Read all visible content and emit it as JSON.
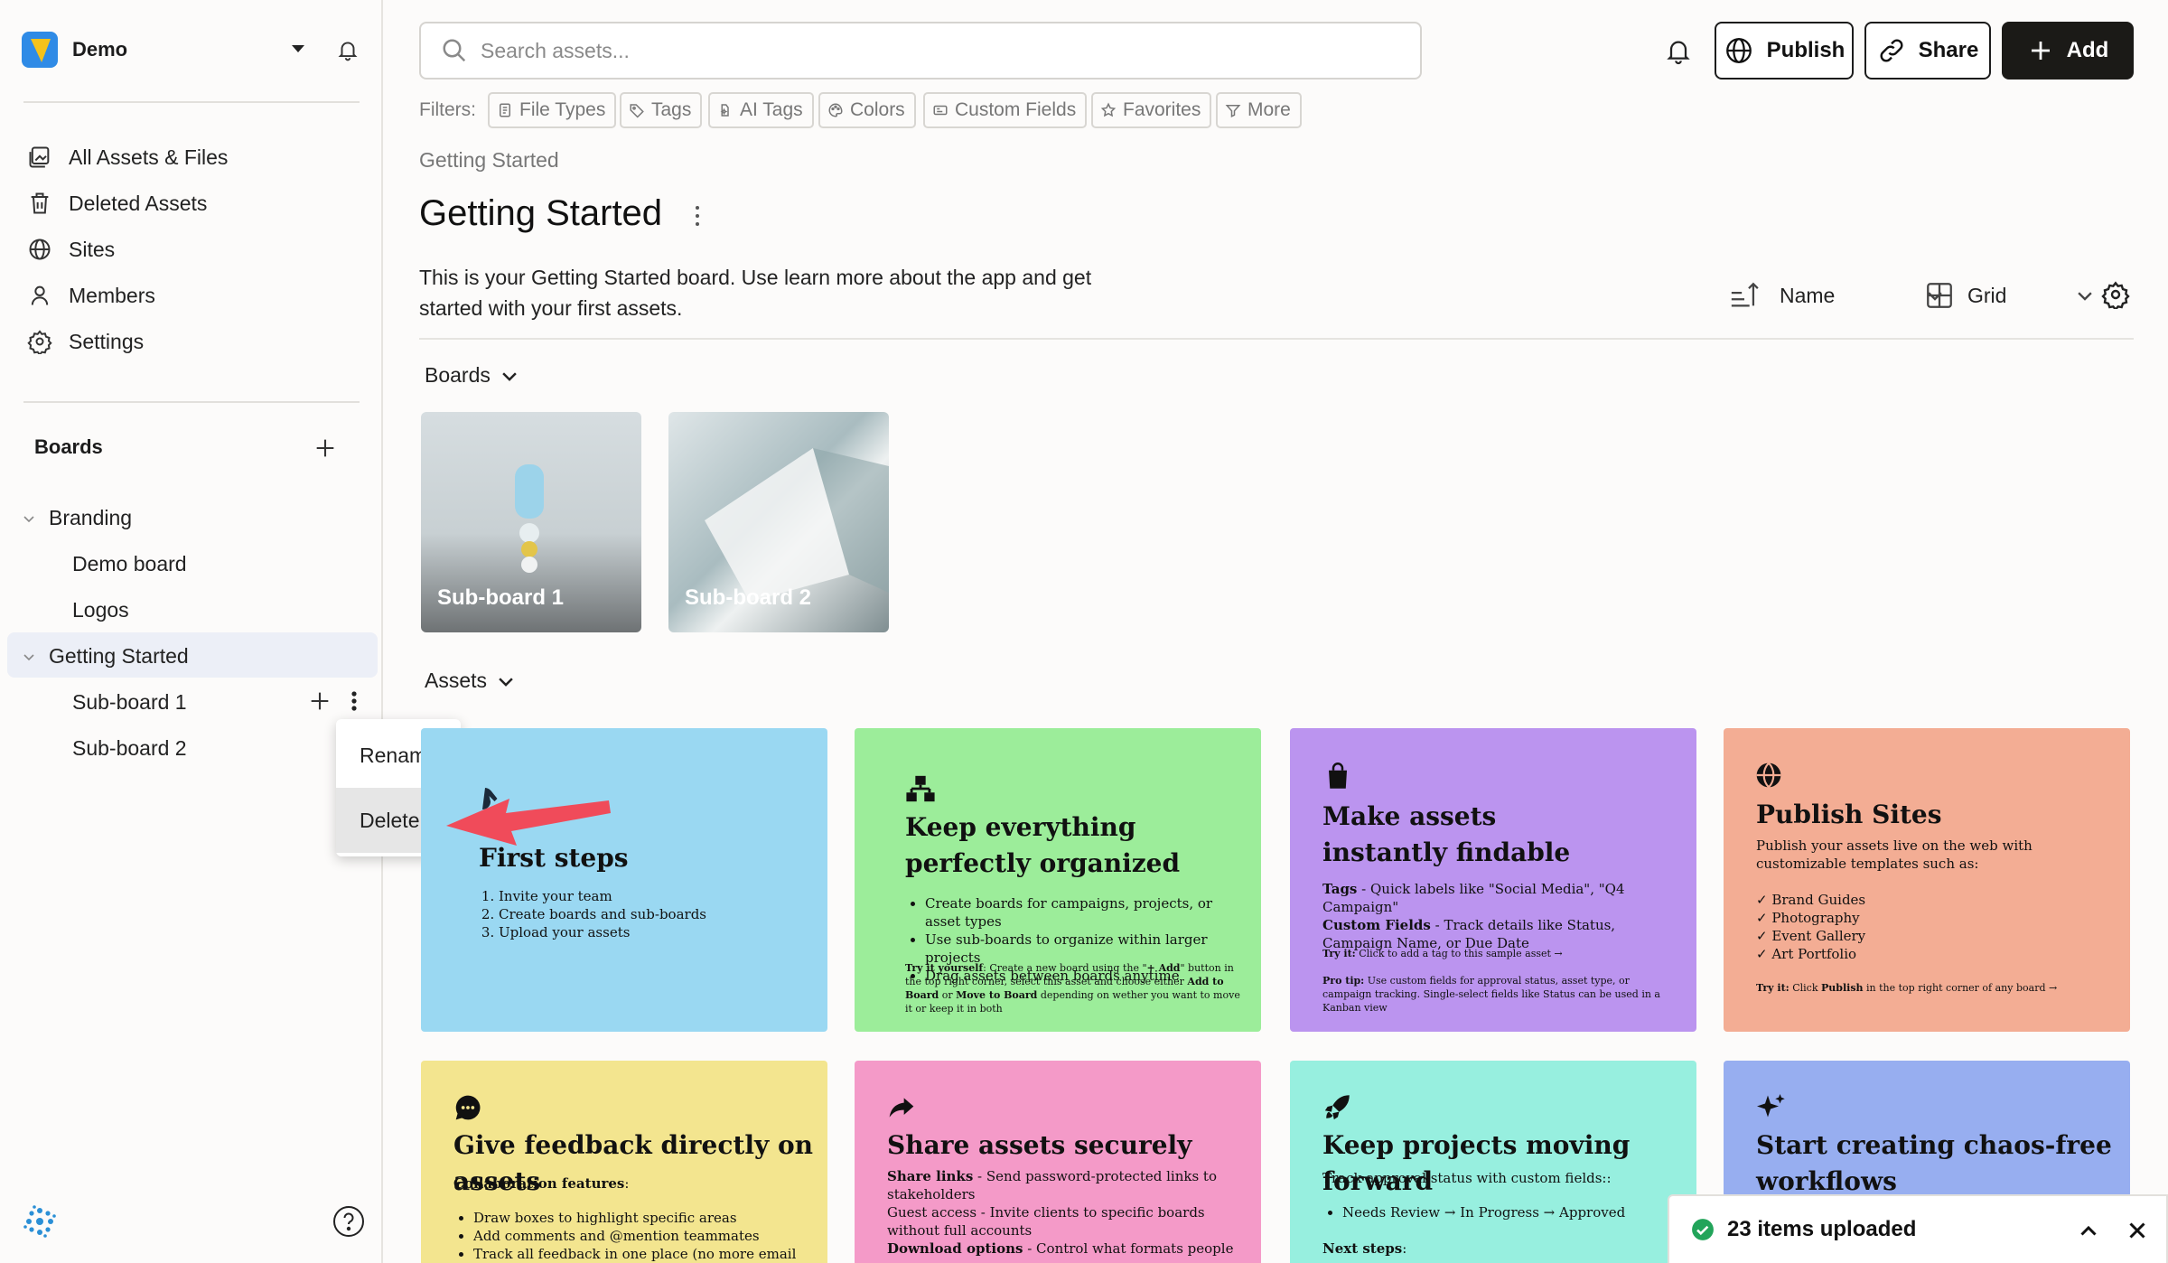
{
  "workspace": {
    "name": "Demo"
  },
  "nav": [
    {
      "label": "All Assets & Files",
      "icon": "assets-icon"
    },
    {
      "label": "Deleted Assets",
      "icon": "trash-icon"
    },
    {
      "label": "Sites",
      "icon": "globe-icon"
    },
    {
      "label": "Members",
      "icon": "person-icon"
    },
    {
      "label": "Settings",
      "icon": "gear-icon"
    }
  ],
  "boards_section": {
    "title": "Boards"
  },
  "tree": {
    "branding": "Branding",
    "demo_board": "Demo board",
    "logos": "Logos",
    "getting_started": "Getting Started",
    "sub1": "Sub-board 1",
    "sub2": "Sub-board 2"
  },
  "context_menu": {
    "rename": "Rename",
    "delete": "Delete"
  },
  "search": {
    "placeholder": "Search assets..."
  },
  "toolbar": {
    "publish": "Publish",
    "share": "Share",
    "add": "Add"
  },
  "filters": {
    "label": "Filters:",
    "chips": [
      "File Types",
      "Tags",
      "AI Tags",
      "Colors",
      "Custom Fields",
      "Favorites",
      "More"
    ]
  },
  "breadcrumb": "Getting Started",
  "page": {
    "title": "Getting Started",
    "description": "This is your Getting Started board. Use learn more about the app and get started with your first assets."
  },
  "view": {
    "sort": "Name",
    "layout": "Grid"
  },
  "sections": {
    "boards": "Boards",
    "assets": "Assets"
  },
  "subboards": [
    "Sub-board 1",
    "Sub-board 2"
  ],
  "cards": [
    {
      "title": "First steps",
      "items": [
        "Invite your team",
        "Create boards and sub-boards",
        "Upload your assets"
      ],
      "color": "#9ad8f2"
    },
    {
      "title1": "Keep everything",
      "title2": "perfectly organized",
      "items": [
        "Create boards for campaigns, projects, or asset types",
        "Use sub-boards to organize within larger projects",
        "Drag assets between boards anytime"
      ],
      "try_label": "Try it yourself",
      "try_1": ": Create a new board using the \"",
      "try_2": "+ Add",
      "try_3": "\" button in the top right corner, select this asset and choose either ",
      "try_4": "Add to Board",
      "try_5": " or ",
      "try_6": "Move to Board",
      "try_7": " depending on wether you want to move it or keep it in both",
      "color": "#9ced9a"
    },
    {
      "title1": "Make assets",
      "title2": "instantly findable",
      "tags_label": "Tags",
      "tags_text": " - Quick labels like \"Social Media\", \"Q4 Campaign\"",
      "fields_label": "Custom Fields",
      "fields_text": " - Track details like Status, Campaign Name, or Due Date",
      "try_label": "Try it:",
      "try_text": " Click to add a tag to this sample asset →",
      "pro_label": "Pro tip:",
      "pro_text": " Use custom fields for approval status, asset type, or campaign tracking. Single-select fields like Status can be used in a Kanban view",
      "color": "#bb94ef"
    },
    {
      "title": "Publish Sites",
      "intro": "Publish your assets live on the web with customizable templates such as:",
      "items": [
        "✓ Brand Guides",
        "✓ Photography",
        "✓ Event Gallery",
        "✓ Art Portfolio"
      ],
      "try_label": "Try it:",
      "try_1": " Click ",
      "try_2": "Publish",
      "try_3": " in the top right corner of any board →",
      "color": "#f3ad94"
    },
    {
      "title": "Give feedback directly on assets",
      "sub": "Collaboration features",
      "sub_suffix": ":",
      "items": [
        "Draw boxes to highlight specific areas",
        "Add comments and @mention teammates",
        "Track all feedback in one place (no more email threads!)"
      ],
      "color": "#f3e58f"
    },
    {
      "title": "Share assets securely",
      "links_label": "Share links",
      "links_text": " - Send password-protected links to stakeholders",
      "guest_text": "Guest access - Invite clients to specific boards without full accounts",
      "dl_label": "Download options",
      "dl_text": " - Control what formats people can",
      "color": "#f49ac8"
    },
    {
      "title": "Keep projects moving forward",
      "intro": "Track approval status with custom fields::",
      "items": [
        "Needs Review → In Progress → Approved"
      ],
      "next": "Next steps",
      "next_suffix": ":",
      "color": "#97efdf"
    },
    {
      "title1": "Start creating chaos-free",
      "title2": "workflows",
      "color": "#97aef0"
    }
  ],
  "toast": {
    "text": "23 items uploaded"
  },
  "colors": {
    "accent": "#1b1a17",
    "success": "#22a45a",
    "arrow": "#f04b5a"
  }
}
